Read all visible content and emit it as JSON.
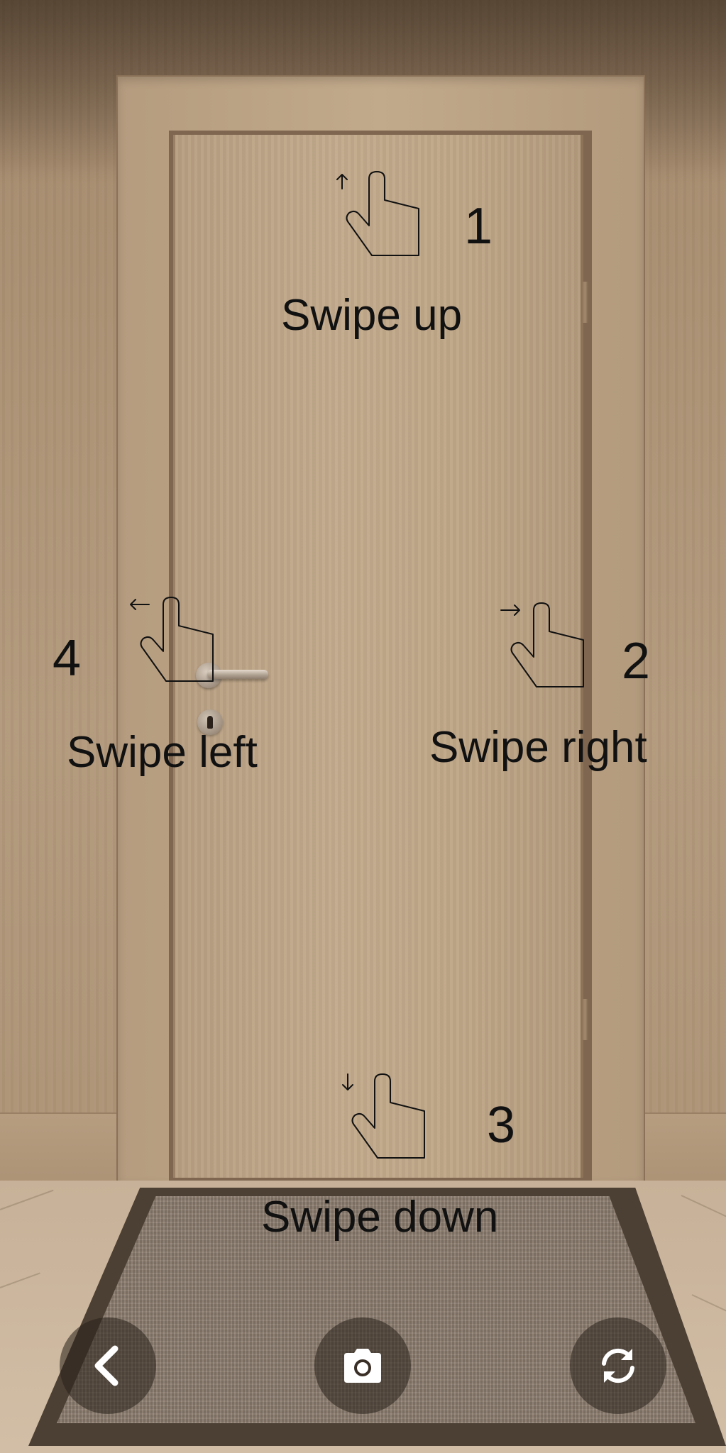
{
  "hints": {
    "up": {
      "number": "1",
      "label": "Swipe up",
      "icon": "hand-swipe-up-icon"
    },
    "right": {
      "number": "2",
      "label": "Swipe right",
      "icon": "hand-swipe-right-icon"
    },
    "down": {
      "number": "3",
      "label": "Swipe down",
      "icon": "hand-swipe-down-icon"
    },
    "left": {
      "number": "4",
      "label": "Swipe left",
      "icon": "hand-swipe-left-icon"
    }
  },
  "toolbar": {
    "back_icon": "chevron-left-icon",
    "camera_icon": "camera-icon",
    "rotate_icon": "rotate-icon"
  },
  "colors": {
    "hint_text": "#111111",
    "button_background": "#28201a",
    "button_icon": "#ffffff"
  }
}
